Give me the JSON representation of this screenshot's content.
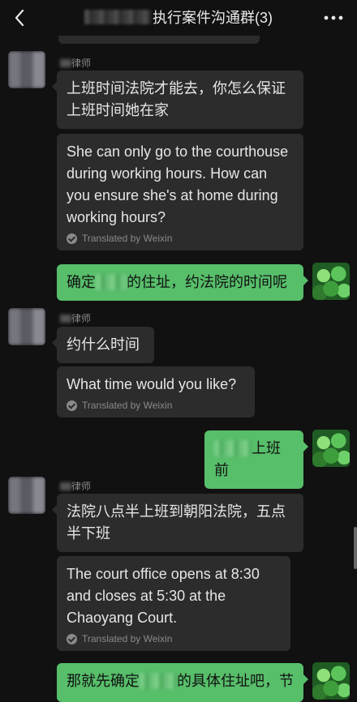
{
  "header": {
    "title": "执行案件沟通群(3)",
    "back_icon": "chevron-left-icon",
    "more_icon": "more-dots-icon"
  },
  "messages": [
    {
      "sender": "律师",
      "text": "上班时间法院才能去，你怎么保证上班时间她在家",
      "translation": "She can only go to the courthouse during working hours. How can you ensure she's at home during working hours?",
      "translated_by": "Translated by Weixin"
    },
    {
      "sender": "me",
      "text_parts": [
        "确定",
        "的住址，约法院的时间呢"
      ]
    },
    {
      "sender": "律师",
      "text": "约什么时间",
      "translation": "What time would you like?",
      "translated_by": "Translated by Weixin"
    },
    {
      "sender": "me",
      "text_parts": [
        "",
        "上班前"
      ]
    },
    {
      "sender": "律师",
      "text": "法院八点半上班到朝阳法院，五点半下班",
      "translation": "The court office opens at 8:30 and closes at 5:30 at the Chaoyang Court.",
      "translated_by": "Translated by Weixin"
    },
    {
      "sender": "me",
      "text_parts": [
        "那就先确定",
        "的具体住址吧，节"
      ]
    }
  ],
  "colors": {
    "background": "#111111",
    "incoming_bubble": "#2c2c2c",
    "outgoing_bubble": "#57be6a"
  }
}
